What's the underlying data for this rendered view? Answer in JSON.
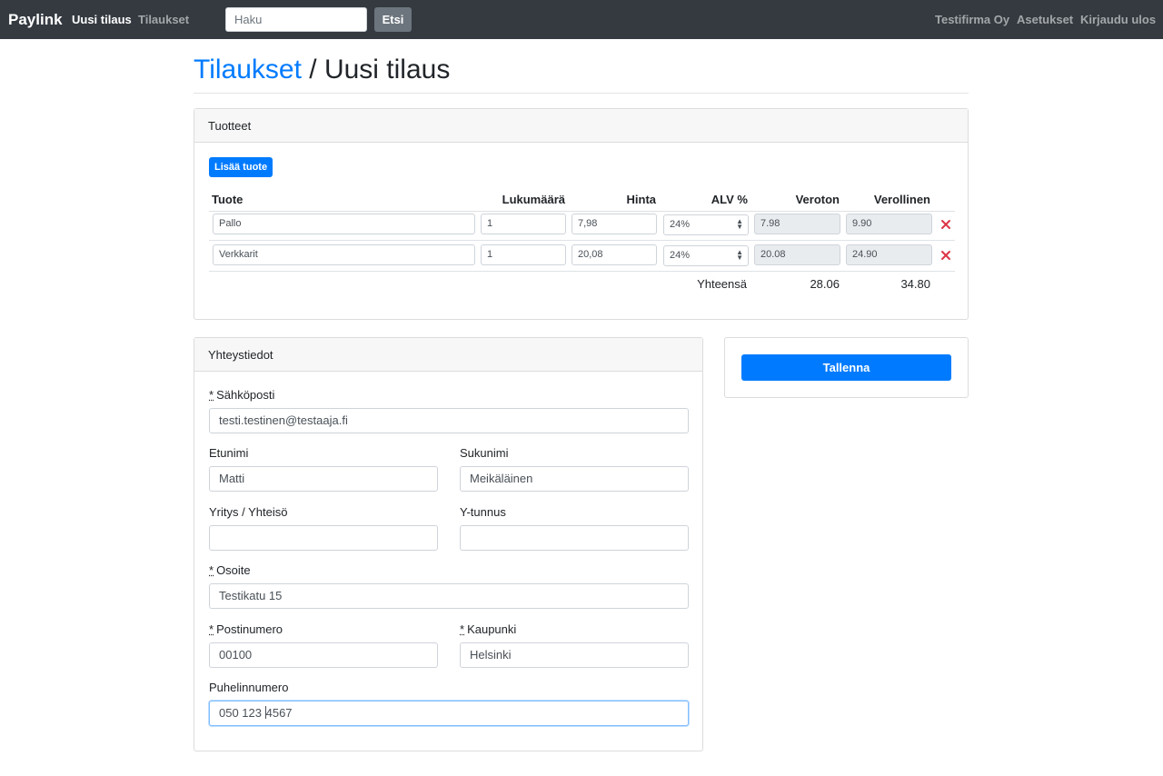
{
  "nav": {
    "brand": "Paylink",
    "links": [
      "Uusi tilaus",
      "Tilaukset"
    ],
    "search_placeholder": "Haku",
    "search_button": "Etsi",
    "right_links": [
      "Testifirma Oy",
      "Asetukset",
      "Kirjaudu ulos"
    ]
  },
  "page": {
    "breadcrumb": "Tilaukset",
    "separator": " / ",
    "title": "Uusi tilaus"
  },
  "products": {
    "header": "Tuotteet",
    "add_button": "Lisää tuote",
    "columns": [
      "Tuote",
      "Lukumäärä",
      "Hinta",
      "ALV %",
      "Veroton",
      "Verollinen"
    ],
    "rows": [
      {
        "product": "Pallo",
        "quantity": "1",
        "price": "7,98",
        "vat": "24%",
        "net": "7.98",
        "gross": "9.90"
      },
      {
        "product": "Verkkarit",
        "quantity": "1",
        "price": "20,08",
        "vat": "24%",
        "net": "20.08",
        "gross": "24.90"
      }
    ],
    "total_label": "Yhteensä",
    "total_net": "28.06",
    "total_gross": "34.80"
  },
  "contact": {
    "header": "Yhteystiedot",
    "required_mark": "*",
    "email_label": "Sähköposti",
    "email": "testi.testinen@testaaja.fi",
    "first_name_label": "Etunimi",
    "first_name": "Matti",
    "last_name_label": "Sukunimi",
    "last_name": "Meikäläinen",
    "company_label": "Yritys / Yhteisö",
    "company": "",
    "business_id_label": "Y-tunnus",
    "business_id": "",
    "address_label": "Osoite",
    "address": "Testikatu 15",
    "postal_code_label": "Postinumero",
    "postal_code": "00100",
    "city_label": "Kaupunki",
    "city": "Helsinki",
    "phone_label": "Puhelinnumero",
    "phone_before_cursor": "050 123 ",
    "phone_after_cursor": "4567"
  },
  "actions": {
    "save_button": "Tallenna"
  },
  "colors": {
    "primary": "#007bff",
    "navbar": "#343a40",
    "danger": "#dc3545"
  }
}
